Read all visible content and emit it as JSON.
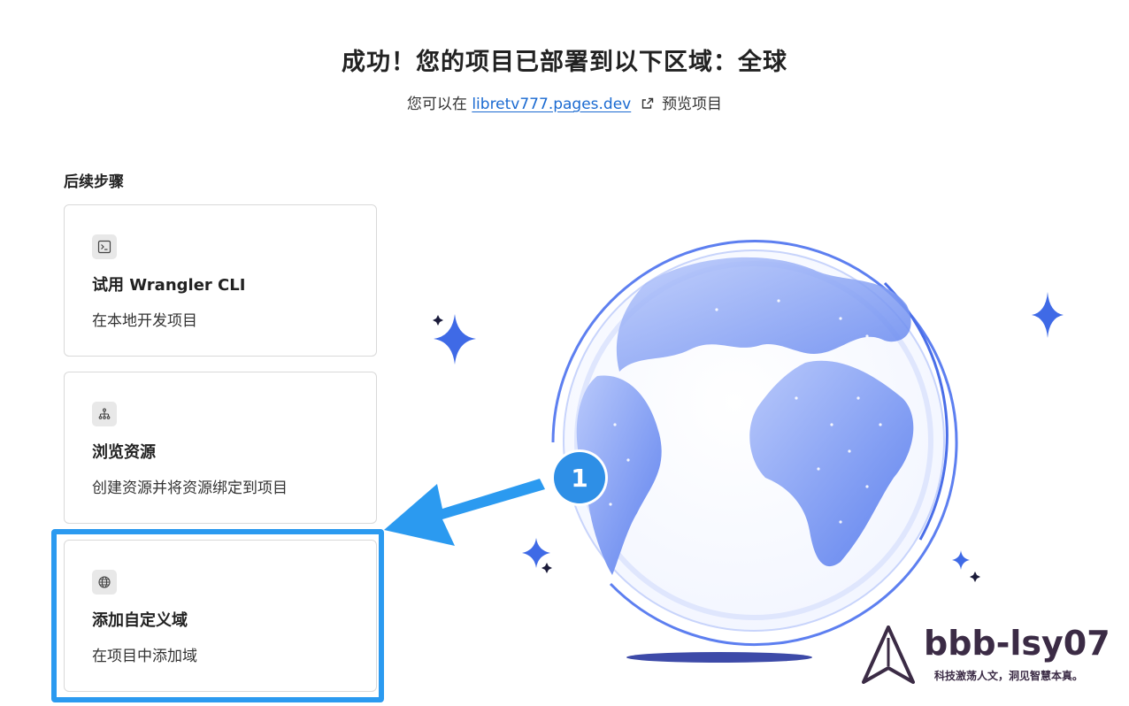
{
  "header": {
    "title": "成功！您的项目已部署到以下区域：全球",
    "subtitle_prefix": "您可以在",
    "site_link": "libretv777.pages.dev",
    "subtitle_suffix": "预览项目"
  },
  "steps": {
    "label": "后续步骤",
    "cards": [
      {
        "icon": "terminal-icon",
        "title": "试用 Wrangler CLI",
        "desc": "在本地开发项目"
      },
      {
        "icon": "sitemap-icon",
        "title": "浏览资源",
        "desc": "创建资源并将资源绑定到项目"
      },
      {
        "icon": "globe-icon",
        "title": "添加自定义域",
        "desc": "在项目中添加域"
      }
    ]
  },
  "annotation": {
    "badge_number": "1",
    "color": "#2b9af0"
  },
  "watermark": {
    "name": "bbb-lsy07",
    "tagline": "科技激荡人文，洞见智慧本真。"
  },
  "colors": {
    "globe_fill": "#6d8ff0",
    "link": "#1a6ad1",
    "sparkle": "#3f6ae6"
  }
}
